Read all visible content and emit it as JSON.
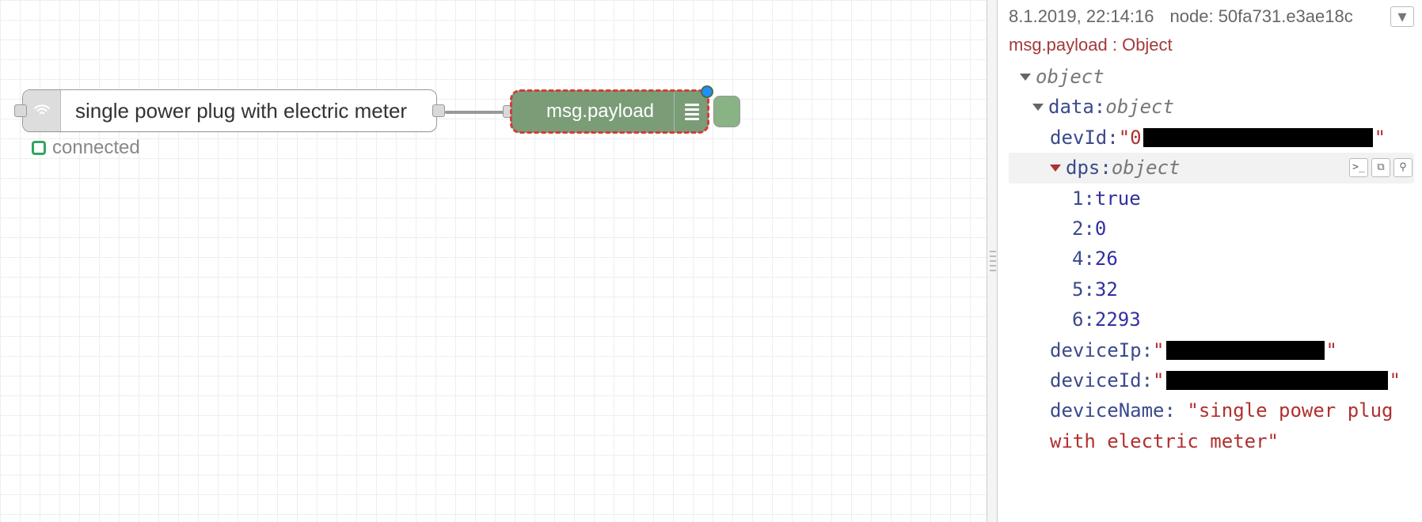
{
  "canvas": {
    "source_node": {
      "label": "single power plug with electric meter",
      "status_text": "connected"
    },
    "debug_node": {
      "label": "msg.payload"
    }
  },
  "sidebar": {
    "timestamp": "8.1.2019, 22:14:16",
    "node_label_prefix": "node:",
    "node_id": "50fa731.e3ae18c",
    "msg_path": "msg.payload : Object",
    "root_type": "object",
    "data_key": "data",
    "data_type": "object",
    "devId_key": "devId",
    "devId_quote_open": "\"0",
    "devId_quote_close": "\"",
    "dps_key": "dps",
    "dps_type": "object",
    "dps": {
      "k1": "1",
      "v1": "true",
      "k2": "2",
      "v2": "0",
      "k4": "4",
      "v4": "26",
      "k5": "5",
      "v5": "32",
      "k6": "6",
      "v6": "2293"
    },
    "deviceIp_key": "deviceIp",
    "deviceIp_open": "\"",
    "deviceIp_close": "\"",
    "deviceId_key": "deviceId",
    "deviceId_open": "\"",
    "deviceId_close": "\"",
    "deviceName_key": "deviceName",
    "deviceName_value": "\"single power plug with electric meter\"",
    "colon": ": "
  }
}
